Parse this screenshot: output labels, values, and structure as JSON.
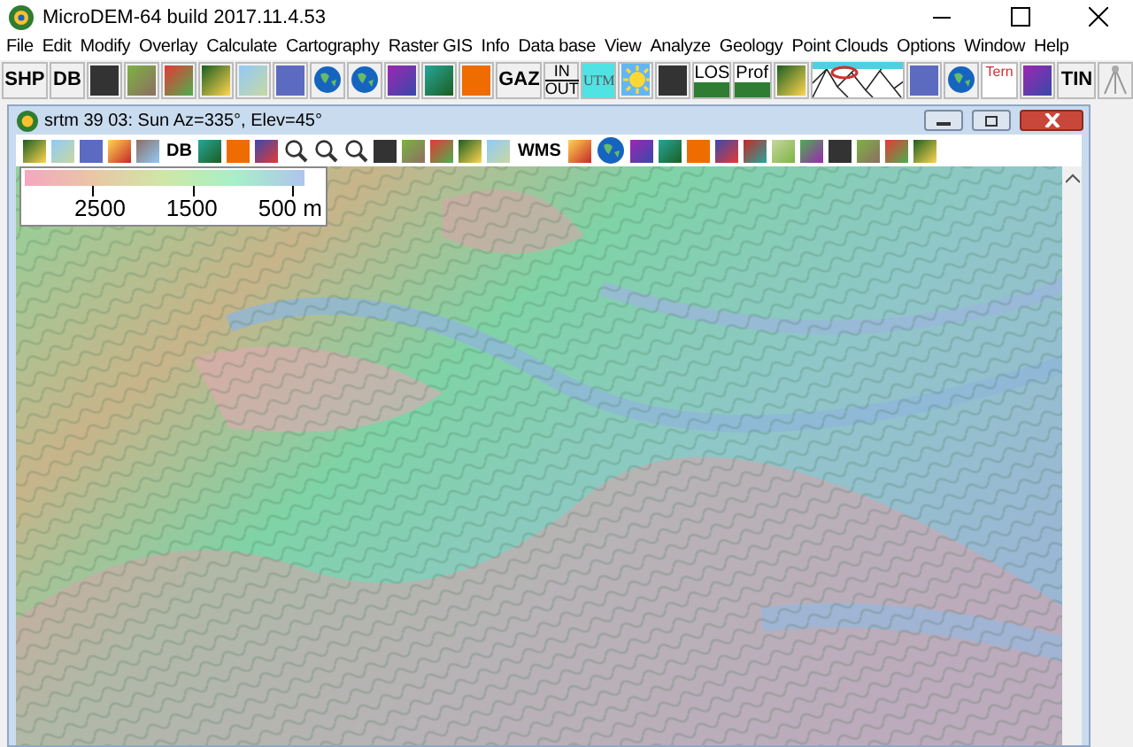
{
  "window": {
    "title": "MicroDEM-64 build 2017.11.4.53"
  },
  "menu": [
    "File",
    "Edit",
    "Modify",
    "Overlay",
    "Calculate",
    "Cartography",
    "Raster GIS",
    "Info",
    "Data base",
    "View",
    "Analyze",
    "Geology",
    "Point Clouds",
    "Options",
    "Window",
    "Help"
  ],
  "toolbar": [
    {
      "kind": "text",
      "label": "SHP"
    },
    {
      "kind": "text",
      "label": "DB"
    },
    {
      "kind": "icon"
    },
    {
      "kind": "icon"
    },
    {
      "kind": "icon"
    },
    {
      "kind": "icon"
    },
    {
      "kind": "icon"
    },
    {
      "kind": "icon"
    },
    {
      "kind": "globe"
    },
    {
      "kind": "globe"
    },
    {
      "kind": "icon"
    },
    {
      "kind": "icon"
    },
    {
      "kind": "icon"
    },
    {
      "kind": "text",
      "label": "GAZ"
    },
    {
      "kind": "stack",
      "label": "IN",
      "label2": "OUT"
    },
    {
      "kind": "tile",
      "label": "UTM"
    },
    {
      "kind": "sun"
    },
    {
      "kind": "icon"
    },
    {
      "kind": "hill",
      "label": "LOS"
    },
    {
      "kind": "hill",
      "label": "Prof"
    },
    {
      "kind": "icon"
    },
    {
      "kind": "mesh"
    },
    {
      "kind": "icon"
    },
    {
      "kind": "globe"
    },
    {
      "kind": "tri",
      "label": "Tern"
    },
    {
      "kind": "icon"
    },
    {
      "kind": "text",
      "label": "TIN"
    },
    {
      "kind": "tripod"
    }
  ],
  "map_window": {
    "title": "srtm 39 03: Sun Az=335°, Elev=45°",
    "toolbar": [
      {
        "kind": "icon"
      },
      {
        "kind": "icon"
      },
      {
        "kind": "icon"
      },
      {
        "kind": "icon"
      },
      {
        "kind": "icon"
      },
      {
        "kind": "text",
        "label": "DB"
      },
      {
        "kind": "icon"
      },
      {
        "kind": "icon"
      },
      {
        "kind": "icon"
      },
      {
        "kind": "zoom"
      },
      {
        "kind": "zoom"
      },
      {
        "kind": "zoom"
      },
      {
        "kind": "icon"
      },
      {
        "kind": "icon"
      },
      {
        "kind": "icon"
      },
      {
        "kind": "icon"
      },
      {
        "kind": "icon"
      },
      {
        "kind": "text",
        "label": "WMS"
      },
      {
        "kind": "icon"
      },
      {
        "kind": "globe"
      },
      {
        "kind": "icon"
      },
      {
        "kind": "icon"
      },
      {
        "kind": "icon"
      },
      {
        "kind": "icon"
      },
      {
        "kind": "icon"
      },
      {
        "kind": "icon"
      },
      {
        "kind": "icon"
      },
      {
        "kind": "icon"
      },
      {
        "kind": "icon"
      },
      {
        "kind": "icon"
      },
      {
        "kind": "icon"
      }
    ],
    "legend": {
      "labels": [
        "2500",
        "1500",
        "500 m"
      ]
    }
  }
}
